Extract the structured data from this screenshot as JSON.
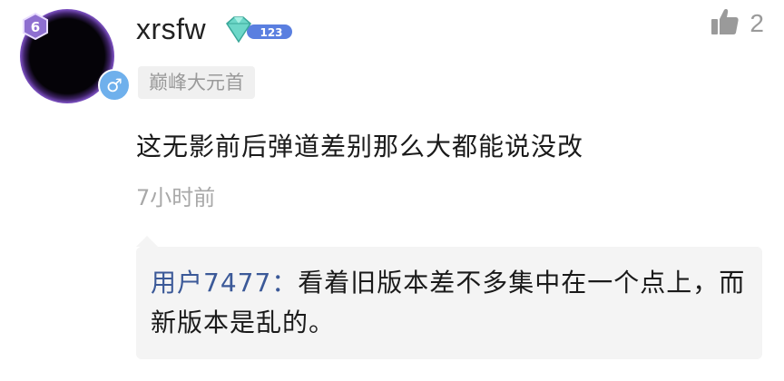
{
  "comment": {
    "level": "6",
    "gender_icon": "male-icon",
    "username": "xrsfw",
    "vip_number": "123",
    "title_tag": "巅峰大元首",
    "like_count": "2",
    "text": "这无影前后弹道差别那么大都能说没改",
    "time": "7小时前"
  },
  "reply": {
    "user": "用户7477",
    "separator": "：",
    "text": "看着旧版本差不多集中在一个点上，而新版本是乱的。"
  },
  "colors": {
    "reply_user": "#3b5998",
    "gender_badge": "#6fb0ec",
    "reply_bg": "#f4f4f4"
  }
}
